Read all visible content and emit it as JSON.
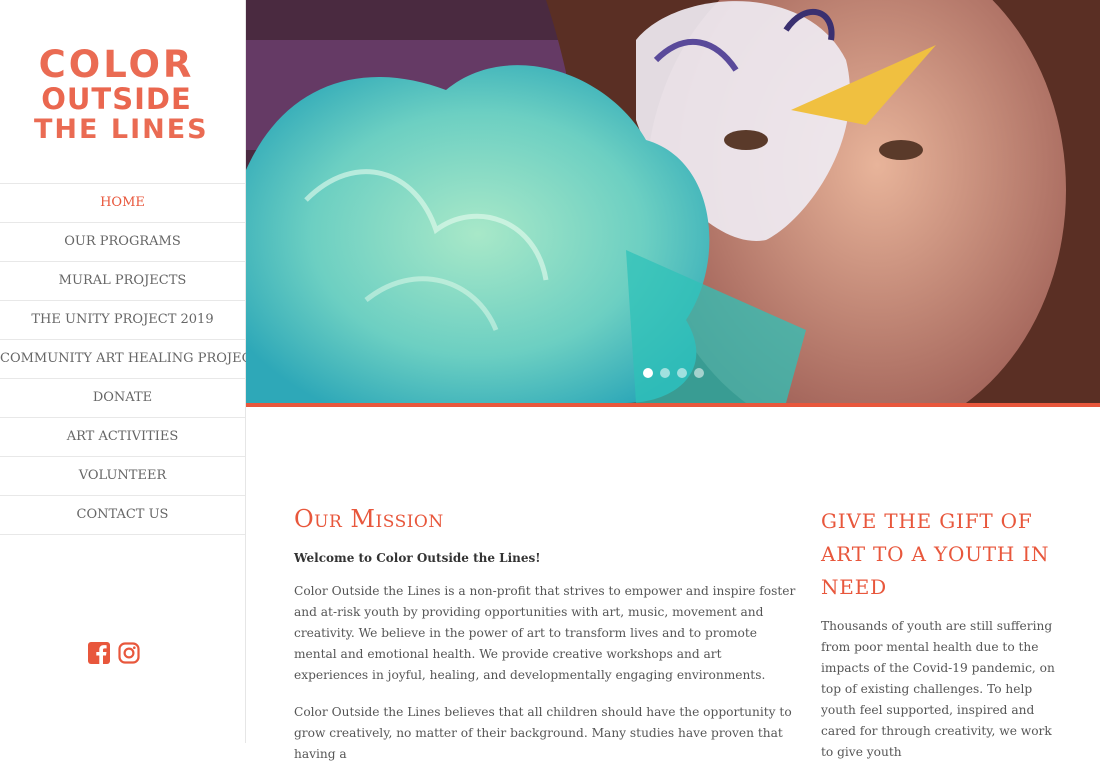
{
  "logo": {
    "line1": "COLOR",
    "line2": "OUTSIDE",
    "line3": "THE LINES"
  },
  "nav": {
    "items": [
      {
        "label": "HOME",
        "active": true
      },
      {
        "label": "OUR PROGRAMS"
      },
      {
        "label": "MURAL PROJECTS"
      },
      {
        "label": "THE UNITY PROJECT 2019"
      },
      {
        "label": "COMMUNITY ART HEALING PROJECTS"
      },
      {
        "label": "DONATE"
      },
      {
        "label": "ART ACTIVITIES"
      },
      {
        "label": "VOLUNTEER"
      },
      {
        "label": "CONTACT US"
      }
    ]
  },
  "social": {
    "icons": [
      "facebook-icon",
      "instagram-icon"
    ]
  },
  "slider": {
    "slide_count": 4,
    "active_slide": 1
  },
  "colors": {
    "accent": "#e8573c",
    "text": "#555555",
    "heading_dark": "#333333"
  },
  "mission": {
    "title": "Our Mission",
    "welcome": "Welcome to Color Outside the Lines!",
    "para1": "Color Outside the Lines is a non-profit that strives to empower and inspire foster and at-risk youth by providing opportunities with art, music, movement and creativity. We believe in the power of art to transform lives and to promote mental and emotional health. We provide creative workshops and art experiences in joyful, healing, and developmentally engaging environments.",
    "para2": "Color Outside the Lines believes that all children should have the opportunity to grow creatively, no matter of their background. Many studies have proven that having a"
  },
  "gift": {
    "title": "GIVE THE GIFT OF ART TO A YOUTH IN NEED",
    "body": "Thousands of youth are still suffering from poor mental health due to the impacts of the Covid-19 pandemic, on top of existing challenges. To help youth feel supported, inspired and cared for through creativity, we work to give youth"
  }
}
